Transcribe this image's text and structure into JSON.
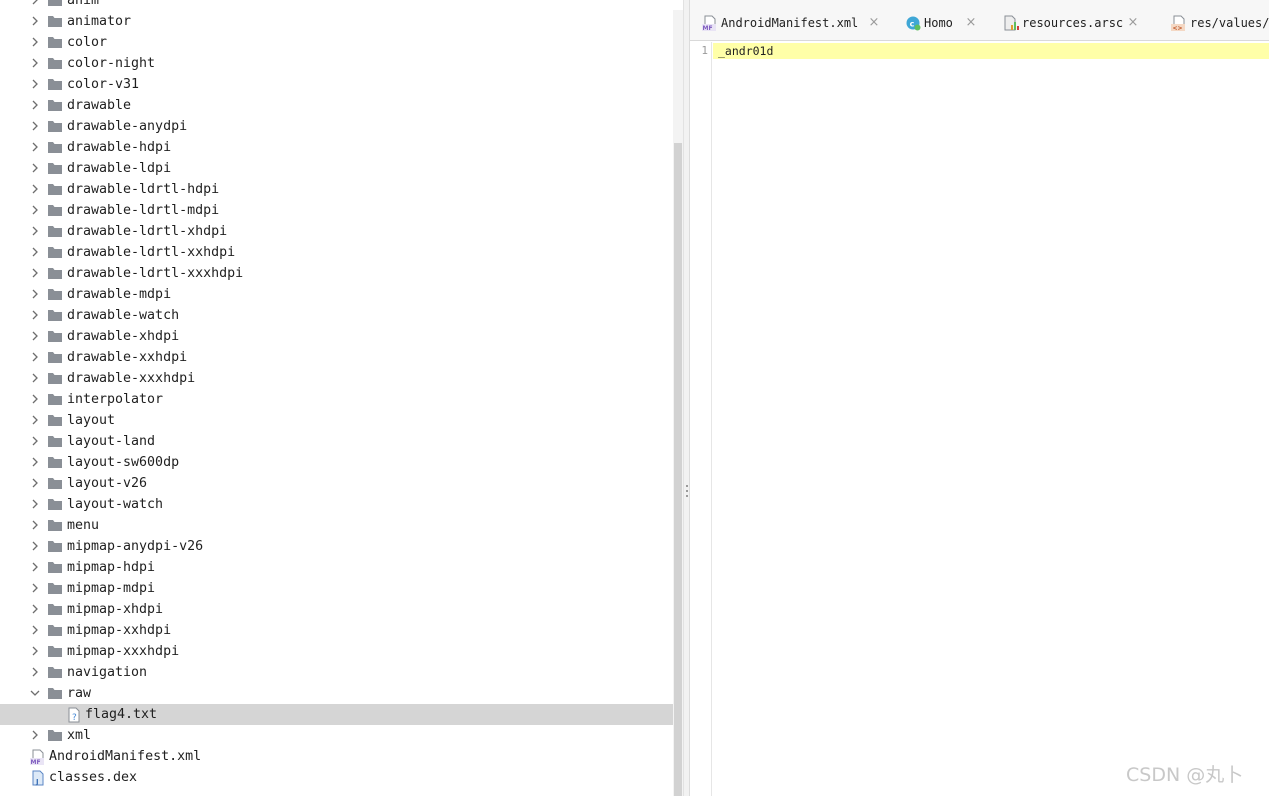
{
  "tree": {
    "folders": [
      {
        "label": "anim",
        "expanded": false
      },
      {
        "label": "animator",
        "expanded": false
      },
      {
        "label": "color",
        "expanded": false
      },
      {
        "label": "color-night",
        "expanded": false
      },
      {
        "label": "color-v31",
        "expanded": false
      },
      {
        "label": "drawable",
        "expanded": false
      },
      {
        "label": "drawable-anydpi",
        "expanded": false
      },
      {
        "label": "drawable-hdpi",
        "expanded": false
      },
      {
        "label": "drawable-ldpi",
        "expanded": false
      },
      {
        "label": "drawable-ldrtl-hdpi",
        "expanded": false
      },
      {
        "label": "drawable-ldrtl-mdpi",
        "expanded": false
      },
      {
        "label": "drawable-ldrtl-xhdpi",
        "expanded": false
      },
      {
        "label": "drawable-ldrtl-xxhdpi",
        "expanded": false
      },
      {
        "label": "drawable-ldrtl-xxxhdpi",
        "expanded": false
      },
      {
        "label": "drawable-mdpi",
        "expanded": false
      },
      {
        "label": "drawable-watch",
        "expanded": false
      },
      {
        "label": "drawable-xhdpi",
        "expanded": false
      },
      {
        "label": "drawable-xxhdpi",
        "expanded": false
      },
      {
        "label": "drawable-xxxhdpi",
        "expanded": false
      },
      {
        "label": "interpolator",
        "expanded": false
      },
      {
        "label": "layout",
        "expanded": false
      },
      {
        "label": "layout-land",
        "expanded": false
      },
      {
        "label": "layout-sw600dp",
        "expanded": false
      },
      {
        "label": "layout-v26",
        "expanded": false
      },
      {
        "label": "layout-watch",
        "expanded": false
      },
      {
        "label": "menu",
        "expanded": false
      },
      {
        "label": "mipmap-anydpi-v26",
        "expanded": false
      },
      {
        "label": "mipmap-hdpi",
        "expanded": false
      },
      {
        "label": "mipmap-mdpi",
        "expanded": false
      },
      {
        "label": "mipmap-xhdpi",
        "expanded": false
      },
      {
        "label": "mipmap-xxhdpi",
        "expanded": false
      },
      {
        "label": "mipmap-xxxhdpi",
        "expanded": false
      },
      {
        "label": "navigation",
        "expanded": false
      },
      {
        "label": "raw",
        "expanded": true
      }
    ],
    "raw_child": {
      "label": "flag4.txt",
      "selected": true
    },
    "after_raw": [
      {
        "label": "xml",
        "expanded": false
      }
    ],
    "root_files": [
      {
        "label": "AndroidManifest.xml",
        "icon": "manifest-file-icon"
      },
      {
        "label": "classes.dex",
        "icon": "dex-file-icon"
      }
    ]
  },
  "tabs": [
    {
      "label": "AndroidManifest.xml",
      "icon": "manifest-file-icon"
    },
    {
      "label": "Homo",
      "icon": "class-icon"
    },
    {
      "label": "resources.arsc",
      "icon": "resources-icon"
    },
    {
      "label": "res/values/",
      "icon": "xml-values-icon"
    }
  ],
  "editor": {
    "line_numbers": [
      "1"
    ],
    "lines": [
      "_andr01d"
    ]
  },
  "watermark": "CSDN @丸卜",
  "colors": {
    "selection": "#d5d5d5",
    "current_line": "#ffffa8",
    "folder_icon": "#8a8f96"
  }
}
